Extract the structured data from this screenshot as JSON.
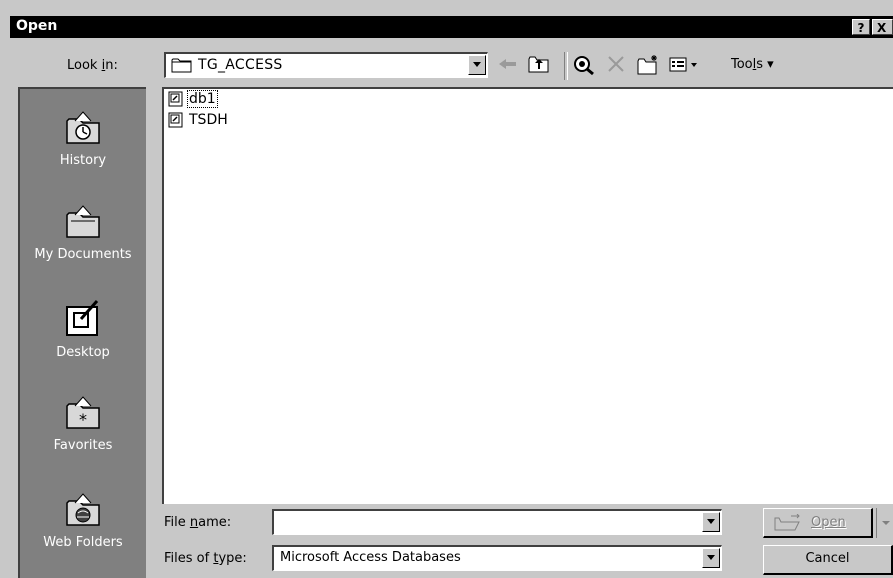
{
  "dialog": {
    "title": "Open",
    "help_label": "?",
    "close_label": "X"
  },
  "toolbar": {
    "look_in_pre": "Look ",
    "look_in_key": "i",
    "look_in_post": "n:",
    "folder": "TG_ACCESS",
    "tools_pre": "Too",
    "tools_key": "l",
    "tools_post": "s ▾"
  },
  "places": [
    {
      "label": "History",
      "icon": "history-icon"
    },
    {
      "label": "My Documents",
      "icon": "my-documents-icon"
    },
    {
      "label": "Desktop",
      "icon": "desktop-icon"
    },
    {
      "label": "Favorites",
      "icon": "favorites-icon"
    },
    {
      "label": "Web Folders",
      "icon": "web-folders-icon"
    }
  ],
  "files": [
    {
      "name": "db1",
      "selected": true
    },
    {
      "name": "TSDH",
      "selected": false
    }
  ],
  "form": {
    "file_name_pre": "File ",
    "file_name_key": "n",
    "file_name_post": "ame:",
    "file_name_value": "",
    "file_type_pre": "Files of ",
    "file_type_key": "t",
    "file_type_post": "ype:",
    "file_type_value": "Microsoft Access Databases"
  },
  "buttons": {
    "open_key": "O",
    "open_rest": "pen",
    "cancel": "Cancel"
  }
}
